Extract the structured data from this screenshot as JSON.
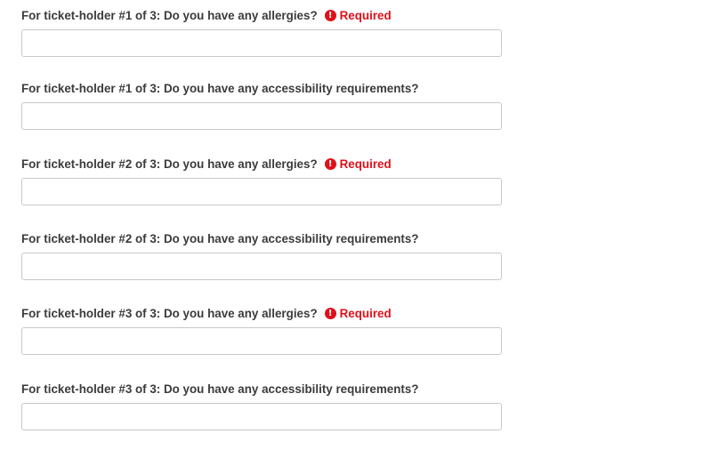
{
  "form": {
    "required_label": "Required",
    "required_icon": "exclamation-circle-icon",
    "required_color": "#e0101a",
    "fields": [
      {
        "label": "For ticket-holder #1 of 3: Do you have any allergies?",
        "required": true,
        "value": "",
        "placeholder": ""
      },
      {
        "label": "For ticket-holder #1 of 3: Do you have any accessibility requirements?",
        "required": false,
        "value": "",
        "placeholder": ""
      },
      {
        "label": "For ticket-holder #2 of 3: Do you have any allergies?",
        "required": true,
        "value": "",
        "placeholder": ""
      },
      {
        "label": "For ticket-holder #2 of 3: Do you have any accessibility requirements?",
        "required": false,
        "value": "",
        "placeholder": ""
      },
      {
        "label": "For ticket-holder #3 of 3: Do you have any allergies?",
        "required": true,
        "value": "",
        "placeholder": ""
      },
      {
        "label": "For ticket-holder #3 of 3: Do you have any accessibility requirements?",
        "required": false,
        "value": "",
        "placeholder": ""
      }
    ]
  }
}
